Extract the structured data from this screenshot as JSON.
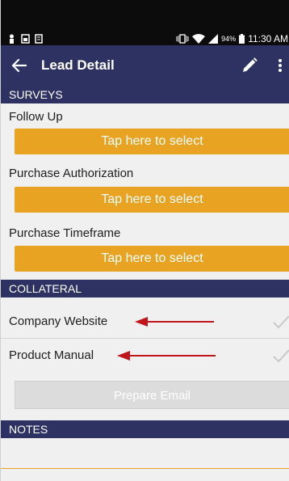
{
  "status_bar": {
    "battery": "94%",
    "time": "11:30 AM"
  },
  "app_bar": {
    "title": "Lead Detail"
  },
  "surveys": {
    "header": "SURVEYS",
    "fields": [
      {
        "label": "Follow Up",
        "button": "Tap here to select"
      },
      {
        "label": "Purchase Authorization",
        "button": "Tap here to select"
      },
      {
        "label": "Purchase Timeframe",
        "button": "Tap here to select"
      }
    ]
  },
  "collateral": {
    "header": "COLLATERAL",
    "items": [
      {
        "label": "Company Website",
        "checked": false
      },
      {
        "label": "Product Manual",
        "checked": false
      }
    ],
    "prepare_email": "Prepare Email"
  },
  "notes": {
    "header": "NOTES",
    "value": ""
  },
  "colors": {
    "header_bg": "#2d3262",
    "select_button": "#e8a323",
    "arrow": "#c0151b",
    "background": "#f0f0f0"
  },
  "icons": [
    "back-arrow-icon",
    "pencil-icon",
    "more-vert-icon",
    "checkmark-icon",
    "wifi-icon",
    "signal-icon",
    "battery-icon"
  ]
}
